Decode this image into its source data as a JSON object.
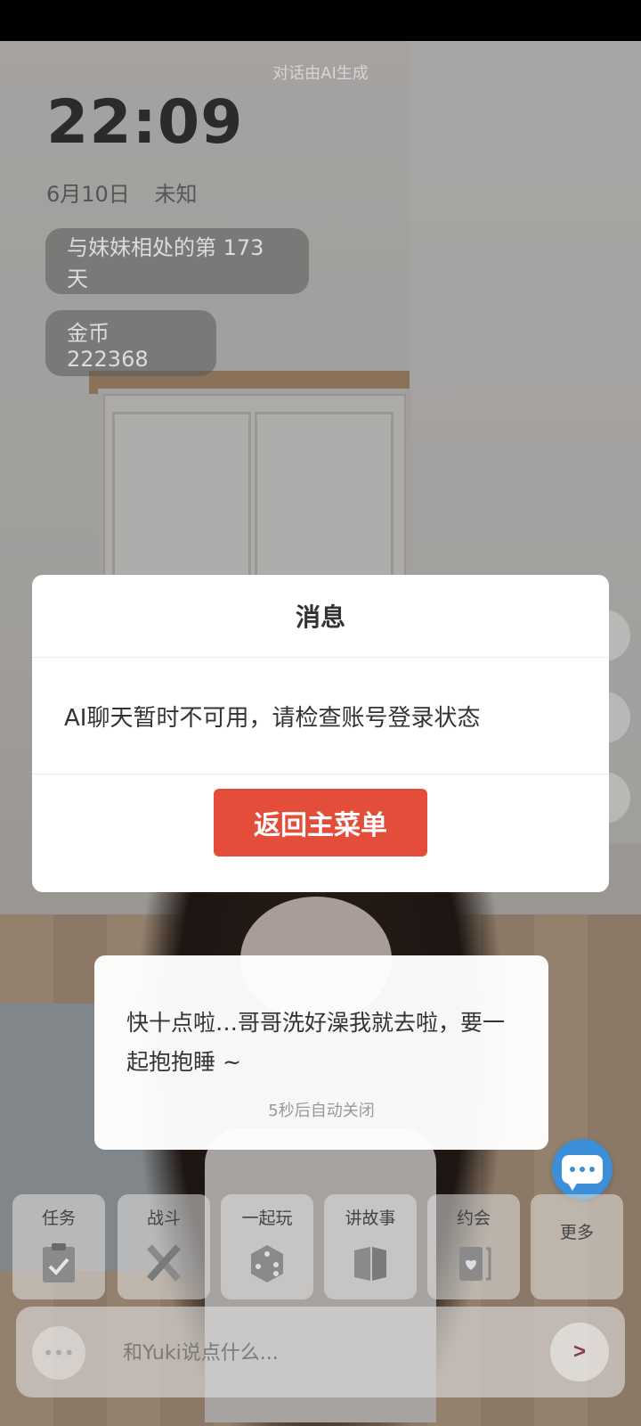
{
  "header": {
    "ai_note": "对话由AI生成",
    "time": "22:09",
    "date": "6月10日",
    "weather": "未知",
    "days_together": "与妹妹相处的第 173 天",
    "coins": "金币 222368"
  },
  "modal": {
    "title": "消息",
    "message": "AI聊天暂时不可用，请检查账号登录状态",
    "button_label": "返回主菜单",
    "button_color": "#e34d3a"
  },
  "toast": {
    "message": "快十点啦…哥哥洗好澡我就去啦，要一起抱抱睡 ~",
    "timer": "5秒后自动关闭"
  },
  "actions": [
    {
      "label": "任务",
      "icon": "clipboard-check-icon"
    },
    {
      "label": "战斗",
      "icon": "crossed-swords-icon"
    },
    {
      "label": "一起玩",
      "icon": "dice-icon"
    },
    {
      "label": "讲故事",
      "icon": "open-book-icon"
    },
    {
      "label": "约会",
      "icon": "heart-card-icon"
    },
    {
      "label": "更多",
      "icon": ""
    }
  ],
  "input": {
    "placeholder": "和Yuki说点什么...",
    "send_label": ">"
  },
  "chat_fab": {
    "icon": "chat-bubble-icon",
    "color": "#3b8fd9"
  }
}
